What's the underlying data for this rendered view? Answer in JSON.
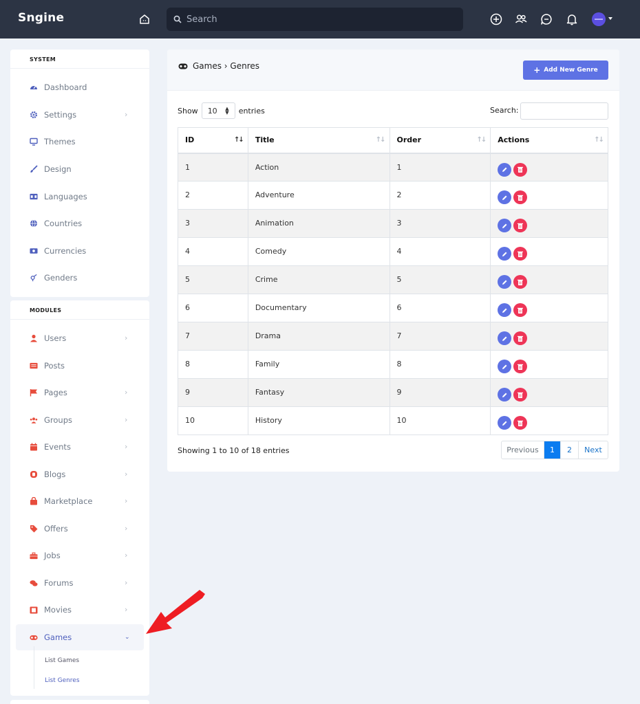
{
  "app": {
    "brand": "Sngine",
    "search_placeholder": "Search"
  },
  "colors": {
    "topbar": "#2c3444",
    "accent": "#5e72e4",
    "danger": "#ee3557",
    "sidebar_icon": "#e74c3c",
    "page_active": "#0b7cf0"
  },
  "sidebar": {
    "system_title": "SYSTEM",
    "system_items": [
      {
        "label": "Dashboard",
        "icon": "dashboard-icon",
        "has_chevron": false
      },
      {
        "label": "Settings",
        "icon": "gear-icon",
        "has_chevron": true
      },
      {
        "label": "Themes",
        "icon": "monitor-icon",
        "has_chevron": false
      },
      {
        "label": "Design",
        "icon": "brush-icon",
        "has_chevron": false
      },
      {
        "label": "Languages",
        "icon": "language-icon",
        "has_chevron": false
      },
      {
        "label": "Countries",
        "icon": "globe-icon",
        "has_chevron": false
      },
      {
        "label": "Currencies",
        "icon": "money-icon",
        "has_chevron": false
      },
      {
        "label": "Genders",
        "icon": "gender-icon",
        "has_chevron": false
      }
    ],
    "modules_title": "MODULES",
    "module_items": [
      {
        "label": "Users",
        "icon": "user-icon",
        "has_chevron": true
      },
      {
        "label": "Posts",
        "icon": "newspaper-icon",
        "has_chevron": false
      },
      {
        "label": "Pages",
        "icon": "flag-icon",
        "has_chevron": true
      },
      {
        "label": "Groups",
        "icon": "users-icon",
        "has_chevron": true
      },
      {
        "label": "Events",
        "icon": "calendar-icon",
        "has_chevron": true
      },
      {
        "label": "Blogs",
        "icon": "blog-icon",
        "has_chevron": true
      },
      {
        "label": "Marketplace",
        "icon": "bag-icon",
        "has_chevron": true
      },
      {
        "label": "Offers",
        "icon": "tag-icon",
        "has_chevron": true
      },
      {
        "label": "Jobs",
        "icon": "briefcase-icon",
        "has_chevron": true
      },
      {
        "label": "Forums",
        "icon": "comments-icon",
        "has_chevron": true
      },
      {
        "label": "Movies",
        "icon": "film-icon",
        "has_chevron": true
      },
      {
        "label": "Games",
        "icon": "gamepad-icon",
        "has_chevron": true,
        "active": true
      }
    ],
    "games_sub": [
      "List Games",
      "List Genres"
    ],
    "games_sub_selected": "List Genres"
  },
  "main": {
    "breadcrumb": "Games › Genres",
    "add_button": "Add New Genre",
    "show_label": "Show",
    "entries_label": "entries",
    "page_length": "10",
    "search_label": "Search:",
    "columns": [
      "ID",
      "Title",
      "Order",
      "Actions"
    ],
    "rows": [
      {
        "id": "1",
        "title": "Action",
        "order": "1"
      },
      {
        "id": "2",
        "title": "Adventure",
        "order": "2"
      },
      {
        "id": "3",
        "title": "Animation",
        "order": "3"
      },
      {
        "id": "4",
        "title": "Comedy",
        "order": "4"
      },
      {
        "id": "5",
        "title": "Crime",
        "order": "5"
      },
      {
        "id": "6",
        "title": "Documentary",
        "order": "6"
      },
      {
        "id": "7",
        "title": "Drama",
        "order": "7"
      },
      {
        "id": "8",
        "title": "Family",
        "order": "8"
      },
      {
        "id": "9",
        "title": "Fantasy",
        "order": "9"
      },
      {
        "id": "10",
        "title": "History",
        "order": "10"
      }
    ],
    "info": "Showing 1 to 10 of 18 entries",
    "pagination": {
      "previous": "Previous",
      "pages": [
        "1",
        "2"
      ],
      "current": "1",
      "next": "Next"
    }
  }
}
